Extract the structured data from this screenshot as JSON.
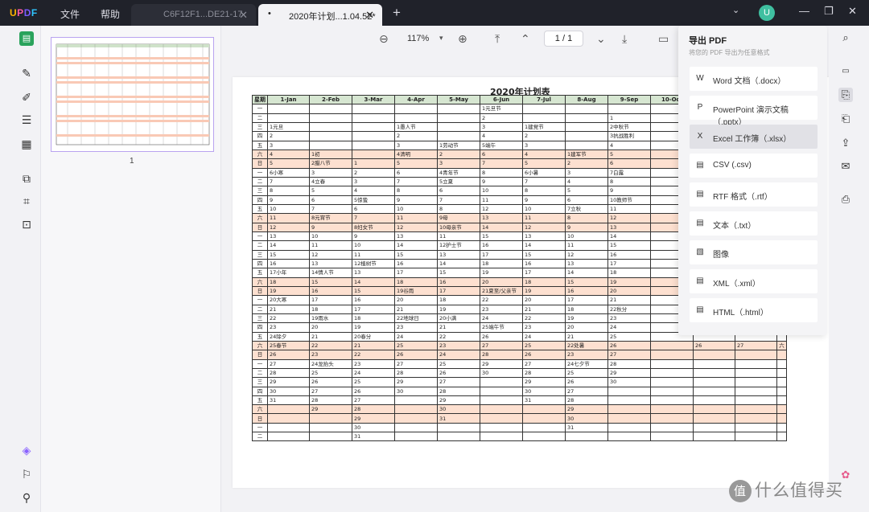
{
  "app": {
    "logo": "UPDF",
    "menu": [
      "文件",
      "帮助"
    ]
  },
  "tabs": [
    {
      "label": "C6F12F1...DE21-17",
      "active": false
    },
    {
      "label": "2020年计划...1.04.52*",
      "active": true
    }
  ],
  "user": {
    "avatar_letter": "U"
  },
  "toolbar": {
    "zoom": "117%",
    "page_indicator": "1  /  1"
  },
  "thumbnail": {
    "page_number": "1"
  },
  "export_panel": {
    "title": "导出 PDF",
    "subtitle": "将您的 PDF 导出为任意格式",
    "options": [
      {
        "label": "Word 文档（.docx）",
        "icon": "word-icon"
      },
      {
        "label": "PowerPoint 演示文稿（.pptx）",
        "icon": "powerpoint-icon"
      },
      {
        "label": "Excel 工作簿（.xlsx）",
        "icon": "excel-icon",
        "selected": true
      },
      {
        "label": "CSV (.csv)",
        "icon": "csv-icon"
      },
      {
        "label": "RTF 格式（.rtf）",
        "icon": "rtf-icon"
      },
      {
        "label": "文本（.txt）",
        "icon": "text-icon"
      },
      {
        "label": "图像",
        "icon": "image-icon"
      },
      {
        "label": "XML（.xml）",
        "icon": "xml-icon"
      },
      {
        "label": "HTML（.html）",
        "icon": "html-icon"
      }
    ]
  },
  "document": {
    "title": "2020年计划表",
    "header": [
      "星期",
      "1-Jan",
      "2-Feb",
      "3-Mar",
      "4-Apr",
      "5-May",
      "6-Jun",
      "7-Jul",
      "8-Aug",
      "9-Sep",
      "10-Oct",
      "",
      "",
      ""
    ],
    "weekday_col": [
      "一",
      "二",
      "三",
      "四",
      "五",
      "六",
      "日",
      "一",
      "二",
      "三",
      "四",
      "五",
      "六",
      "日",
      "一",
      "二",
      "三",
      "四",
      "五",
      "六",
      "日",
      "一",
      "二",
      "三",
      "四",
      "五",
      "六",
      "日",
      "一",
      "二",
      "三",
      "四",
      "五",
      "六",
      "日",
      "一",
      "二",
      "三",
      "四",
      "五",
      "六",
      "日",
      "一",
      "二",
      "三",
      "四",
      "五",
      "六",
      "日"
    ],
    "rows": [
      [
        "",
        "",
        "",
        "",
        "",
        "1元旦节",
        "",
        "",
        "",
        "",
        "",
        "",
        ""
      ],
      [
        "",
        "",
        "",
        "",
        "",
        "2",
        "",
        "",
        "1",
        "",
        "",
        "",
        ""
      ],
      [
        "1元旦",
        "",
        "",
        "1愚人节",
        "",
        "3",
        "1建党节",
        "",
        "2中秋节",
        "",
        "",
        "",
        ""
      ],
      [
        "2",
        "",
        "",
        "2",
        "",
        "4",
        "2",
        "",
        "3抗战胜利",
        "",
        "",
        "",
        ""
      ],
      [
        "3",
        "",
        "",
        "3",
        "1劳动节",
        "5端午",
        "3",
        "",
        "4",
        "",
        "",
        "",
        ""
      ],
      [
        "4",
        "1初",
        "",
        "4清明",
        "2",
        "6",
        "4",
        "1建军节",
        "5",
        "",
        "",
        "",
        ""
      ],
      [
        "5",
        "2腊八节",
        "1",
        "5",
        "3",
        "7",
        "5",
        "2",
        "6",
        "",
        "",
        "",
        ""
      ],
      [
        "6小寒",
        "3",
        "2",
        "6",
        "4青年节",
        "8",
        "6小暑",
        "3",
        "7白露",
        "",
        "",
        "",
        ""
      ],
      [
        "7",
        "4立春",
        "3",
        "7",
        "5立夏",
        "9",
        "7",
        "4",
        "8",
        "",
        "",
        "",
        ""
      ],
      [
        "8",
        "5",
        "4",
        "8",
        "6",
        "10",
        "8",
        "5",
        "9",
        "",
        "",
        "",
        ""
      ],
      [
        "9",
        "6",
        "5惊蛰",
        "9",
        "7",
        "11",
        "9",
        "6",
        "10教师节",
        "",
        "",
        "",
        ""
      ],
      [
        "10",
        "7",
        "6",
        "10",
        "8",
        "12",
        "10",
        "7立秋",
        "11",
        "",
        "",
        "",
        ""
      ],
      [
        "11",
        "8元宵节",
        "7",
        "11",
        "9母",
        "13",
        "11",
        "8",
        "12",
        "",
        "",
        "",
        ""
      ],
      [
        "12",
        "9",
        "8妇女节",
        "12",
        "10母亲节",
        "14",
        "12",
        "9",
        "13",
        "",
        "",
        "",
        ""
      ],
      [
        "13",
        "10",
        "9",
        "13",
        "11",
        "15",
        "13",
        "10",
        "14",
        "",
        "",
        "",
        ""
      ],
      [
        "14",
        "11",
        "10",
        "14",
        "12护士节",
        "16",
        "14",
        "11",
        "15",
        "",
        "",
        "",
        ""
      ],
      [
        "15",
        "12",
        "11",
        "15",
        "13",
        "17",
        "15",
        "12",
        "16",
        "",
        "",
        "",
        ""
      ],
      [
        "16",
        "13",
        "12植树节",
        "16",
        "14",
        "18",
        "16",
        "13",
        "17",
        "",
        "",
        "",
        ""
      ],
      [
        "17小年",
        "14情人节",
        "13",
        "17",
        "15",
        "19",
        "17",
        "14",
        "18",
        "",
        "",
        "",
        ""
      ],
      [
        "18",
        "15",
        "14",
        "18",
        "16",
        "20",
        "18",
        "15",
        "19",
        "",
        "",
        "",
        ""
      ],
      [
        "19",
        "16",
        "15",
        "19谷雨",
        "17",
        "21夏至/父亲节",
        "19",
        "16",
        "20",
        "",
        "",
        "",
        ""
      ],
      [
        "20大寒",
        "17",
        "16",
        "20",
        "18",
        "22",
        "20",
        "17",
        "21",
        "",
        "",
        "",
        ""
      ],
      [
        "21",
        "18",
        "17",
        "21",
        "19",
        "23",
        "21",
        "18",
        "22秋分",
        "",
        "",
        "",
        ""
      ],
      [
        "22",
        "19雨水",
        "18",
        "22地球日",
        "20小满",
        "24",
        "22",
        "19",
        "23",
        "",
        "",
        "",
        ""
      ],
      [
        "23",
        "20",
        "19",
        "23",
        "21",
        "25端午节",
        "23",
        "20",
        "24",
        "",
        "",
        "",
        ""
      ],
      [
        "24除夕",
        "21",
        "20春分",
        "24",
        "22",
        "26",
        "24",
        "21",
        "25",
        "",
        "",
        "",
        ""
      ],
      [
        "25春节",
        "22",
        "21",
        "25",
        "23",
        "27",
        "25",
        "22处暑",
        "26",
        "",
        "26",
        "27",
        "六"
      ],
      [
        "26",
        "23",
        "22",
        "26",
        "24",
        "28",
        "26",
        "23",
        "27",
        "",
        "",
        "",
        ""
      ],
      [
        "27",
        "24龙抬头",
        "23",
        "27",
        "25",
        "29",
        "27",
        "24七夕节",
        "28",
        "",
        "",
        "",
        ""
      ],
      [
        "28",
        "25",
        "24",
        "28",
        "26",
        "30",
        "28",
        "25",
        "29",
        "",
        "",
        "",
        ""
      ],
      [
        "29",
        "26",
        "25",
        "29",
        "27",
        "",
        "29",
        "26",
        "30",
        "",
        "",
        "",
        ""
      ],
      [
        "30",
        "27",
        "26",
        "30",
        "28",
        "",
        "30",
        "27",
        "",
        "",
        "",
        "",
        ""
      ],
      [
        "31",
        "28",
        "27",
        "",
        "29",
        "",
        "31",
        "28",
        "",
        "",
        "",
        "",
        ""
      ],
      [
        "",
        "29",
        "28",
        "",
        "30",
        "",
        "",
        "29",
        "",
        "",
        "",
        "",
        ""
      ],
      [
        "",
        "",
        "29",
        "",
        "31",
        "",
        "",
        "30",
        "",
        "",
        "",
        "",
        ""
      ],
      [
        "",
        "",
        "30",
        "",
        "",
        "",
        "",
        "31",
        "",
        "",
        "",
        "",
        ""
      ],
      [
        "",
        "",
        "31",
        "",
        "",
        "",
        "",
        "",
        "",
        "",
        "",
        "",
        ""
      ]
    ]
  }
}
